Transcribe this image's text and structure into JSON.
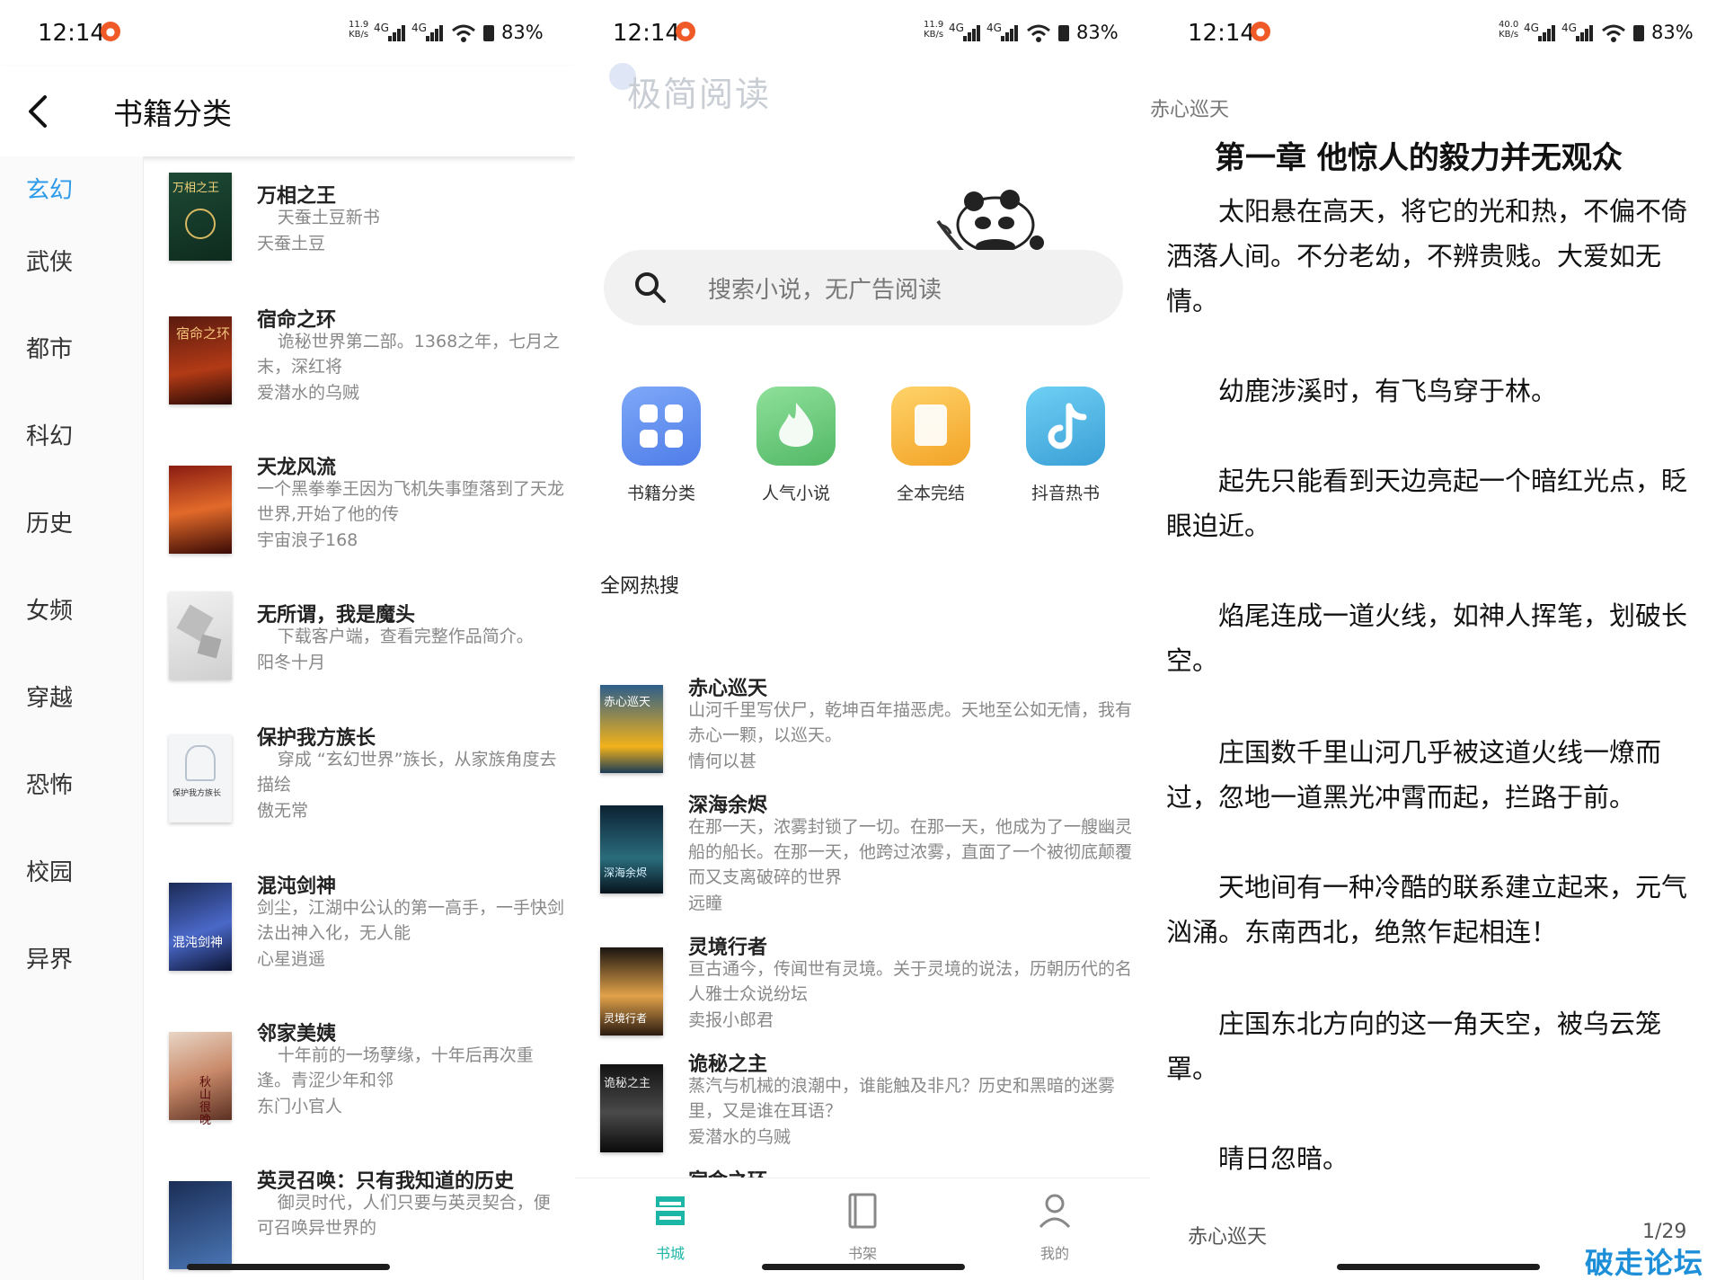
{
  "status": {
    "p1": {
      "time": "12:14",
      "speed_value": "11.9",
      "speed_unit": "KB/s",
      "battery": "83%"
    },
    "p2": {
      "time": "12:14",
      "speed_value": "11.9",
      "speed_unit": "KB/s",
      "battery": "83%"
    },
    "p3": {
      "time": "12:14",
      "speed_value": "40.0",
      "speed_unit": "KB/s",
      "battery": "83%"
    },
    "network": "4G"
  },
  "category_screen": {
    "title": "书籍分类",
    "categories": [
      {
        "label": "玄幻",
        "active": true
      },
      {
        "label": "武侠"
      },
      {
        "label": "都市"
      },
      {
        "label": "科幻"
      },
      {
        "label": "历史"
      },
      {
        "label": "女频"
      },
      {
        "label": "穿越"
      },
      {
        "label": "恐怖"
      },
      {
        "label": "校园"
      },
      {
        "label": "异界"
      }
    ],
    "books": [
      {
        "title": "万相之王",
        "desc": "天蚕土豆新书",
        "author": "天蚕土豆",
        "cover_text": "万相之王"
      },
      {
        "title": "宿命之环",
        "desc": "诡秘世界第二部。1368之年，七月之末，深红将",
        "author": "爱潜水的乌贼",
        "cover_text": "宿命之环"
      },
      {
        "title": "天龙风流",
        "desc": "一个黑拳拳王因为飞机失事堕落到了天龙世界,开始了他的传",
        "author": "宇宙浪子168",
        "cover_text": ""
      },
      {
        "title": "无所谓，我是魔头",
        "desc": "下载客户端，查看完整作品简介。",
        "author": "阳冬十月",
        "cover_text": ""
      },
      {
        "title": "保护我方族长",
        "desc": "穿成 “玄幻世界”族长，从家族角度去描绘",
        "author": "傲无常",
        "cover_text": "保护我方族长"
      },
      {
        "title": "混沌剑神",
        "desc": "剑尘，江湖中公认的第一高手，一手快剑法出神入化，无人能",
        "author": "心星逍遥",
        "cover_text": "混沌剑神"
      },
      {
        "title": "邻家美姨",
        "desc": "十年前的一场孽缘，十年后再次重逢。青涩少年和邻",
        "author": "东门小官人",
        "cover_text": "秋山很晚"
      },
      {
        "title": "英灵召唤：只有我知道的历史",
        "desc": "御灵时代，人们只要与英灵契合，便可召唤异世界的",
        "author": "",
        "cover_text": ""
      }
    ]
  },
  "home_screen": {
    "logo": "极简阅读",
    "search_placeholder": "搜索小说，无广告阅读",
    "quick_links": [
      {
        "label": "书籍分类",
        "icon": "grid-icon",
        "color": "#5b8ff0"
      },
      {
        "label": "人气小说",
        "icon": "flame-icon",
        "color": "#6fcf7e"
      },
      {
        "label": "全本完结",
        "icon": "book-icon",
        "color": "#f6b73c"
      },
      {
        "label": "抖音热书",
        "icon": "tiktok-icon",
        "color": "#4fb7e6"
      }
    ],
    "hot_title": "全网热搜",
    "hot_books": [
      {
        "title": "赤心巡天",
        "desc": "山河千里写伏尸，乾坤百年描恶虎。天地至公如无情，我有赤心一颗，以巡天。",
        "author": "情何以甚",
        "cover_text": "赤心巡天"
      },
      {
        "title": "深海余烬",
        "desc": "在那一天，浓雾封锁了一切。在那一天，他成为了一艘幽灵船的船长。在那一天，他跨过浓雾，直面了一个被彻底颠覆而又支离破碎的世界",
        "author": "远瞳",
        "cover_text": "深海余烬"
      },
      {
        "title": "灵境行者",
        "desc": "亘古通今，传闻世有灵境。关于灵境的说法，历朝历代的名人雅士众说纷坛",
        "author": "卖报小郎君",
        "cover_text": "灵境行者"
      },
      {
        "title": "诡秘之主",
        "desc": "蒸汽与机械的浪潮中，谁能触及非凡？历史和黑暗的迷雾里，又是谁在耳语？",
        "author": "爱潜水的乌贼",
        "cover_text": "诡秘之主"
      },
      {
        "title": "宿命之环",
        "desc": "",
        "author": "",
        "cover_text": ""
      }
    ],
    "tabs": [
      {
        "label": "书城",
        "icon": "store-icon",
        "active": true
      },
      {
        "label": "书架",
        "icon": "bookshelf-icon"
      },
      {
        "label": "我的",
        "icon": "profile-icon"
      }
    ]
  },
  "reader_screen": {
    "book_title": "赤心巡天",
    "chapter_title": "第一章 他惊人的毅力并无观众",
    "paragraphs": [
      "太阳悬在高天，将它的光和热，不偏不倚洒落人间。不分老幼，不辨贵贱。大爱如无情。",
      "幼鹿涉溪时，有飞鸟穿于林。",
      "起先只能看到天边亮起一个暗红光点，眨眼迫近。",
      "焰尾连成一道火线，如神人挥笔，划破长空。",
      "庄国数千里山河几乎被这道火线一燎而过，忽地一道黑光冲霄而起，拦路于前。",
      "天地间有一种冷酷的联系建立起来，元气汹涌。东南西北，绝煞乍起相连！",
      "庄国东北方向的这一角天空，被乌云笼罩。",
      "晴日忽暗。"
    ],
    "footer_book": "赤心巡天",
    "page": "1/29",
    "watermark": "破走论坛"
  },
  "colors": {
    "accent_blue": "#2d9bea",
    "accent_teal": "#1cb6a7",
    "badge_orange": "#f05a28"
  }
}
